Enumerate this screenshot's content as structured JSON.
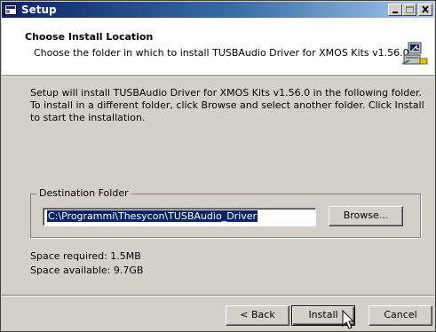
{
  "window": {
    "title": "Setup",
    "controls": {
      "minimize": "minimize-icon",
      "maximize": "maximize-icon",
      "close": "close-icon"
    }
  },
  "header": {
    "title": "Choose Install Location",
    "subtitle": "Choose the folder in which to install TUSBAudio Driver for XMOS Kits v1.56.0.",
    "icon": "installer-icon"
  },
  "body": {
    "description": "Setup will install TUSBAudio Driver for XMOS Kits v1.56.0 in the following folder. To install in a different folder, click Browse and select another folder. Click Install to start the installation.",
    "destination": {
      "group_label": "Destination Folder",
      "path": "C:\\Programmi\\Thesycon\\TUSBAudio_Driver",
      "browse_label": "Browse..."
    },
    "space_required": "Space required: 1.5MB",
    "space_available": "Space available: 9.7GB"
  },
  "footer": {
    "back_label": "< Back",
    "install_label": "Install",
    "cancel_label": "Cancel"
  },
  "colors": {
    "face": "#D4D0C8",
    "title_active_start": "#0A246A",
    "title_active_end": "#A6CAF0",
    "selection": "#0A246A"
  }
}
